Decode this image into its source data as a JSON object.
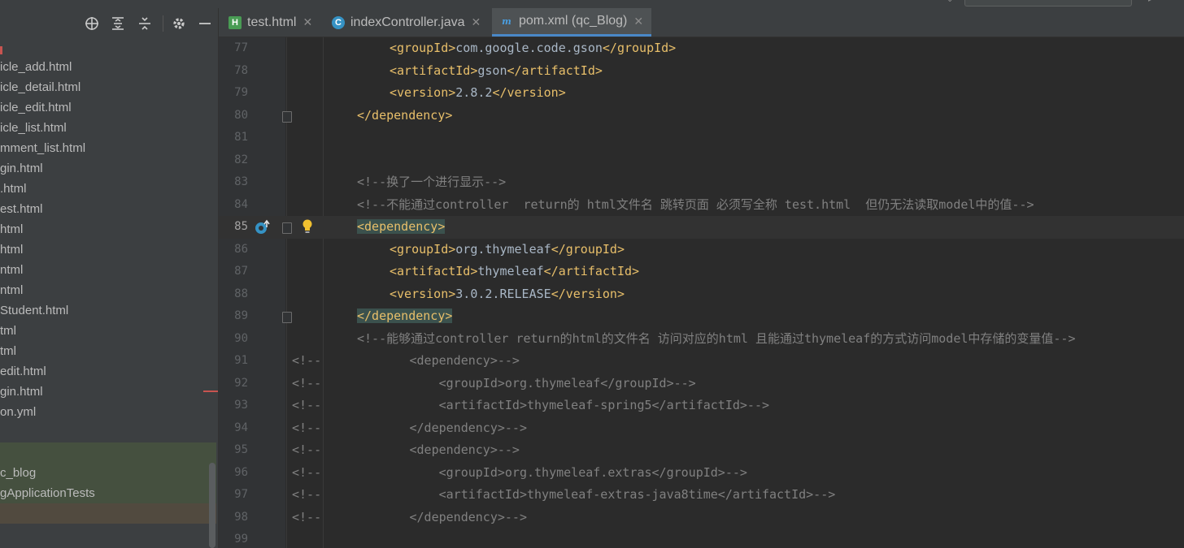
{
  "project_panel": {
    "toolbar_icons": [
      "crosshair-icon",
      "expand-all-icon",
      "collapse-all-icon",
      "gear-icon",
      "minimize-icon"
    ],
    "files": [
      "icle_add.html",
      "icle_detail.html",
      "icle_edit.html",
      "icle_list.html",
      "mment_list.html",
      "gin.html",
      ".html",
      "est.html",
      "html",
      "html",
      "ntml",
      "ntml",
      "Student.html",
      "tml",
      "tml",
      "edit.html",
      "gin.html",
      "on.yml"
    ],
    "test_items": [
      "c_blog",
      "gApplicationTests"
    ]
  },
  "tabs": [
    {
      "label": "test.html",
      "icon": "html-file-icon",
      "active": false
    },
    {
      "label": "indexController.java",
      "icon": "java-class-icon",
      "active": false
    },
    {
      "label": "pom.xml (qc_Blog)",
      "icon": "maven-icon",
      "active": true
    }
  ],
  "editor": {
    "current_line": 85,
    "lines": [
      {
        "num": "77",
        "parts": [
          [
            "tag",
            "<groupId>"
          ],
          [
            "txt",
            "com.google.code.gson"
          ],
          [
            "tag",
            "</groupId>"
          ]
        ]
      },
      {
        "num": "78",
        "parts": [
          [
            "tag",
            "<artifactId>"
          ],
          [
            "txt",
            "gson"
          ],
          [
            "tag",
            "</artifactId>"
          ]
        ]
      },
      {
        "num": "79",
        "parts": [
          [
            "tag",
            "<version>"
          ],
          [
            "txt",
            "2.8.2"
          ],
          [
            "tag",
            "</version>"
          ]
        ]
      },
      {
        "num": "80",
        "parts": [
          [
            "tag",
            "</dependency>"
          ]
        ]
      },
      {
        "num": "81",
        "parts": []
      },
      {
        "num": "82",
        "parts": []
      },
      {
        "num": "83",
        "parts": [
          [
            "cmt",
            "<!--换了一个进行显示-->"
          ]
        ]
      },
      {
        "num": "84",
        "parts": [
          [
            "cmt",
            "<!--不能通过controller  return的 html文件名 跳转页面 必须写全称 test.html  但仍无法读取model中的值-->"
          ]
        ]
      },
      {
        "num": "85",
        "parts": [
          [
            "tag tagbg",
            "<dependency>"
          ]
        ]
      },
      {
        "num": "86",
        "parts": [
          [
            "tag",
            "<groupId>"
          ],
          [
            "txt",
            "org.thymeleaf"
          ],
          [
            "tag",
            "</groupId>"
          ]
        ]
      },
      {
        "num": "87",
        "parts": [
          [
            "tag",
            "<artifactId>"
          ],
          [
            "txt",
            "thymeleaf"
          ],
          [
            "tag",
            "</artifactId>"
          ]
        ]
      },
      {
        "num": "88",
        "parts": [
          [
            "tag",
            "<version>"
          ],
          [
            "txt",
            "3.0.2.RELEASE"
          ],
          [
            "tag",
            "</version>"
          ]
        ]
      },
      {
        "num": "89",
        "parts": [
          [
            "tag tagbg",
            "</dependency>"
          ]
        ]
      },
      {
        "num": "90",
        "parts": [
          [
            "cmt",
            "<!--能够通过controller return的html的文件名 访问对应的html 且能通过thymeleaf的方式访问model中存储的变量值-->"
          ]
        ]
      },
      {
        "num": "91",
        "parts": [
          [
            "cmt",
            "<!--            <dependency>-->"
          ]
        ]
      },
      {
        "num": "92",
        "parts": [
          [
            "cmt",
            "<!--                <groupId>org.thymeleaf</groupId>-->"
          ]
        ]
      },
      {
        "num": "93",
        "parts": [
          [
            "cmt",
            "<!--                <artifactId>thymeleaf-spring5</artifactId>-->"
          ]
        ]
      },
      {
        "num": "94",
        "parts": [
          [
            "cmt",
            "<!--            </dependency>-->"
          ]
        ]
      },
      {
        "num": "95",
        "parts": [
          [
            "cmt",
            "<!--            <dependency>-->"
          ]
        ]
      },
      {
        "num": "96",
        "parts": [
          [
            "cmt",
            "<!--                <groupId>org.thymeleaf.extras</groupId>-->"
          ]
        ]
      },
      {
        "num": "97",
        "parts": [
          [
            "cmt",
            "<!--                <artifactId>thymeleaf-extras-java8time</artifactId>-->"
          ]
        ]
      },
      {
        "num": "98",
        "parts": [
          [
            "cmt",
            "<!--            </dependency>-->"
          ]
        ]
      },
      {
        "num": "99",
        "parts": []
      }
    ]
  }
}
